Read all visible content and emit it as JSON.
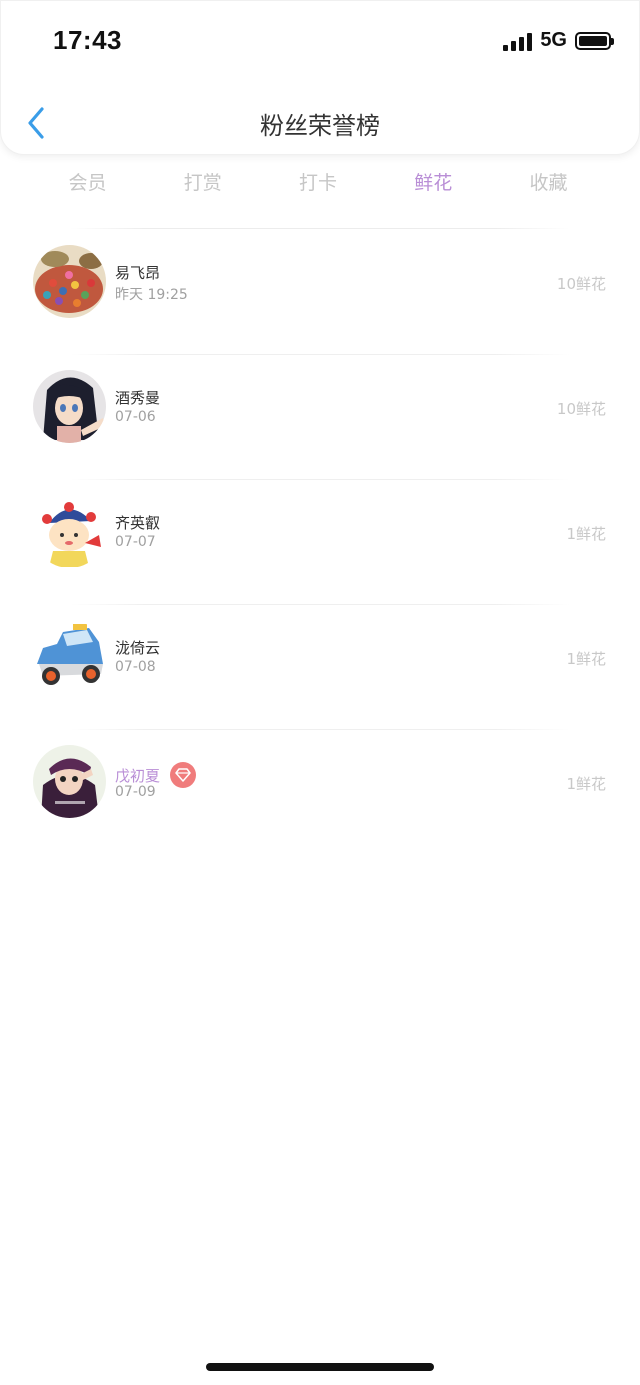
{
  "status_bar": {
    "time": "17:43",
    "network": "5G",
    "icons": [
      "signal-icon",
      "battery-icon"
    ]
  },
  "header": {
    "title": "粉丝荣誉榜",
    "back_icon": "chevron-left-icon",
    "accent_color": "#3a9de8"
  },
  "tabs": [
    {
      "label": "会员",
      "active": false
    },
    {
      "label": "打赏",
      "active": false
    },
    {
      "label": "打卡",
      "active": false
    },
    {
      "label": "鲜花",
      "active": true
    },
    {
      "label": "收藏",
      "active": false
    }
  ],
  "colors": {
    "tab_active": "#b98ed6",
    "tab_inactive": "#c6c6c6",
    "vip_name": "#b98ed6",
    "vip_badge": "#f07c7c"
  },
  "fans": [
    {
      "name": "易飞昂",
      "date": "昨天 19:25",
      "count": "10鲜花",
      "avatar_icon": "candy-photo-avatar",
      "vip": false
    },
    {
      "name": "酒秀曼",
      "date": "07-06",
      "count": "10鲜花",
      "avatar_icon": "anime-girl-avatar",
      "vip": false
    },
    {
      "name": "齐英叡",
      "date": "07-07",
      "count": "1鲜花",
      "avatar_icon": "cartoon-child-avatar",
      "vip": false
    },
    {
      "name": "泷倚云",
      "date": "07-08",
      "count": "1鲜花",
      "avatar_icon": "toy-car-avatar",
      "vip": false
    },
    {
      "name": "戊初夏",
      "date": "07-09",
      "count": "1鲜花",
      "avatar_icon": "girl-photo-avatar",
      "vip": true,
      "badge_icon": "diamond-icon"
    }
  ]
}
